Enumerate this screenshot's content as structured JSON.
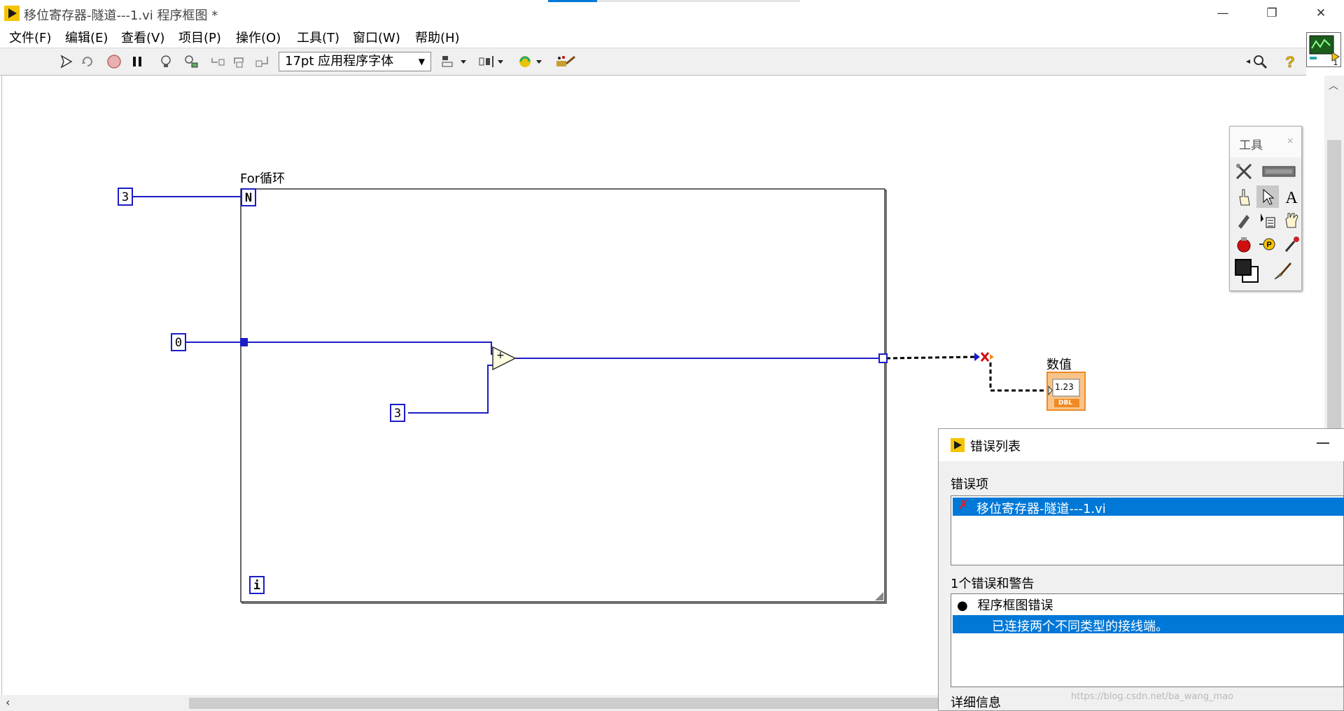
{
  "window": {
    "title": "移位寄存器-隧道---1.vi 程序框图 *",
    "controls": {
      "minimize": "—",
      "restore": "❐",
      "close": "✕"
    }
  },
  "menu": [
    "文件(F)",
    "编辑(E)",
    "查看(V)",
    "项目(P)",
    "操作(O)",
    "工具(T)",
    "窗口(W)",
    "帮助(H)"
  ],
  "toolbar": {
    "font_select": "17pt 应用程序字体",
    "icons": [
      "run-icon",
      "run-continuously-icon",
      "abort-icon",
      "pause-icon",
      "highlight-execution-icon",
      "retain-wire-values-icon",
      "step-into-icon",
      "step-over-icon",
      "step-out-icon",
      "align-icon",
      "distribute-icon",
      "reorder-icon",
      "cleanup-icon",
      "search-icon",
      "help-icon"
    ]
  },
  "diagram": {
    "for_loop_label": "For循环",
    "count_terminal": "N",
    "iteration_terminal": "i",
    "count_constant": "3",
    "init_constant": "0",
    "add_constant": "3",
    "add_symbol": "+",
    "indicator_label": "数值",
    "indicator_value": "1.23",
    "indicator_type": "DBL",
    "wire_color": "#1c1cc6",
    "broken_wire_color": "#000000",
    "indicator_color": "#f08a24"
  },
  "tools_palette": {
    "title": "工具",
    "close": "×"
  },
  "error_list": {
    "title": "错误列表",
    "minimize": "—",
    "items_label": "错误项",
    "items": [
      "移位寄存器-隧道---1.vi"
    ],
    "count_label": "1个错误和警告",
    "group": "程序框图错误",
    "message": "已连接两个不同类型的接线端。",
    "details_label": "详细信息"
  },
  "watermark": "https://blog.csdn.net/ba_wang_mao"
}
